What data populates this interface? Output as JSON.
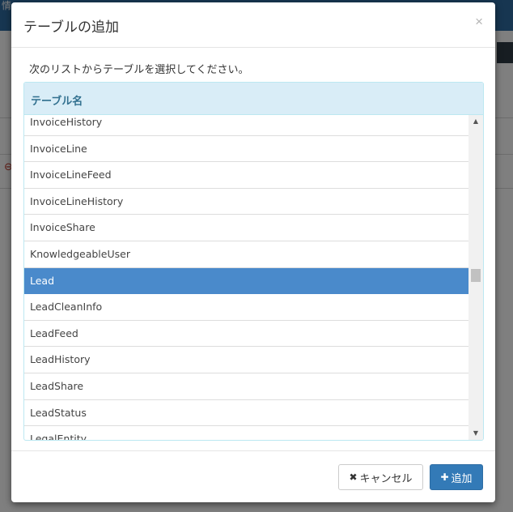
{
  "background": {
    "topbar_text": "情"
  },
  "modal": {
    "title": "テーブルの追加",
    "close_glyph": "×",
    "description": "次のリストからテーブルを選択してください。",
    "table_header": "テーブル名",
    "rows": [
      "InvoiceHistory",
      "InvoiceLine",
      "InvoiceLineFeed",
      "InvoiceLineHistory",
      "InvoiceShare",
      "KnowledgeableUser",
      "Lead",
      "LeadCleanInfo",
      "LeadFeed",
      "LeadHistory",
      "LeadShare",
      "LeadStatus",
      "LegalEntity"
    ],
    "selected_row": "Lead",
    "buttons": {
      "cancel_label": "キャンセル",
      "add_label": "追加"
    }
  },
  "colors": {
    "selected_row_bg": "#4a8acb",
    "header_bg": "#d9edf7",
    "primary_button": "#337ab7"
  }
}
